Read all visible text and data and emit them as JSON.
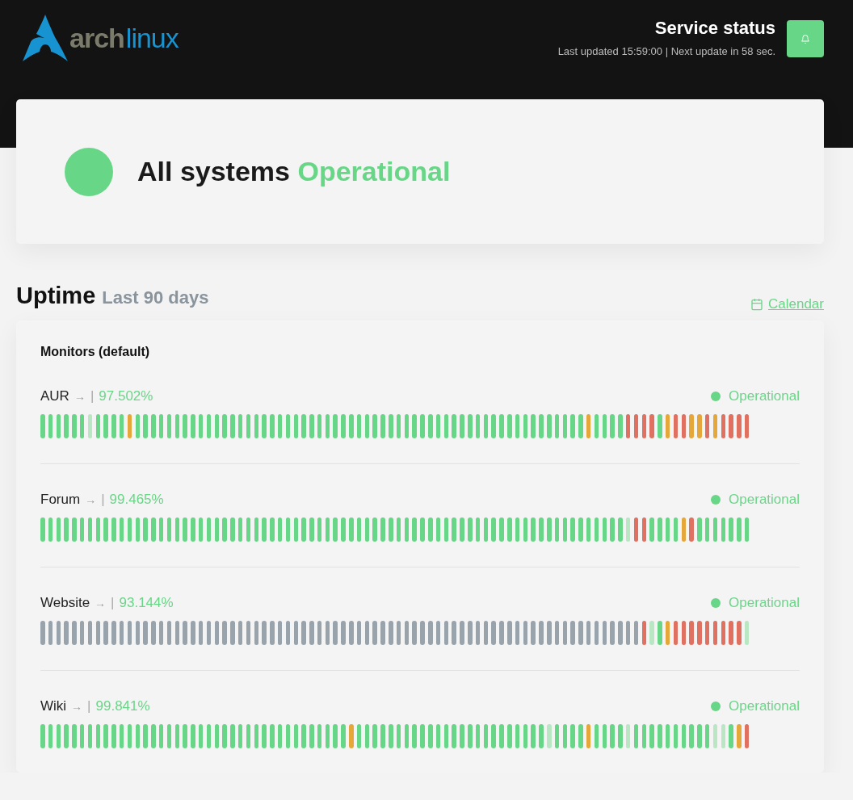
{
  "header": {
    "logo": {
      "part_1": "arch",
      "part_2": "linux"
    },
    "title": "Service status",
    "subtitle": "Last updated 15:59:00 | Next update in 58 sec."
  },
  "overall": {
    "color": "#68d687",
    "prefix": "All systems",
    "status_text": "Operational"
  },
  "uptime": {
    "title": "Uptime",
    "period": "Last 90 days",
    "calendar_link": "Calendar"
  },
  "monitors_group": {
    "title": "Monitors (default)",
    "monitors": [
      {
        "name": "AUR",
        "arrow": "→",
        "separator": "|",
        "uptime": "97.502%",
        "color": "#68d687",
        "status_text": "Operational",
        "days": [
          {
            "color": "#68d687"
          },
          {
            "color": "#68d687"
          },
          {
            "color": "#68d687"
          },
          {
            "color": "#68d687"
          },
          {
            "color": "#68d687"
          },
          {
            "color": "#68d687"
          },
          {
            "color": "#b9e6c3"
          },
          {
            "color": "#68d687"
          },
          {
            "color": "#68d687"
          },
          {
            "color": "#68d687"
          },
          {
            "color": "#68d687"
          },
          {
            "color": "#e5a73a"
          },
          {
            "color": "#68d687"
          },
          {
            "color": "#68d687"
          },
          {
            "color": "#68d687"
          },
          {
            "color": "#68d687"
          },
          {
            "color": "#68d687"
          },
          {
            "color": "#68d687"
          },
          {
            "color": "#68d687"
          },
          {
            "color": "#68d687"
          },
          {
            "color": "#68d687"
          },
          {
            "color": "#68d687"
          },
          {
            "color": "#68d687"
          },
          {
            "color": "#68d687"
          },
          {
            "color": "#68d687"
          },
          {
            "color": "#68d687"
          },
          {
            "color": "#68d687"
          },
          {
            "color": "#68d687"
          },
          {
            "color": "#68d687"
          },
          {
            "color": "#68d687"
          },
          {
            "color": "#68d687"
          },
          {
            "color": "#68d687"
          },
          {
            "color": "#68d687"
          },
          {
            "color": "#68d687"
          },
          {
            "color": "#68d687"
          },
          {
            "color": "#68d687"
          },
          {
            "color": "#68d687"
          },
          {
            "color": "#68d687"
          },
          {
            "color": "#68d687"
          },
          {
            "color": "#68d687"
          },
          {
            "color": "#68d687"
          },
          {
            "color": "#68d687"
          },
          {
            "color": "#68d687"
          },
          {
            "color": "#68d687"
          },
          {
            "color": "#68d687"
          },
          {
            "color": "#68d687"
          },
          {
            "color": "#68d687"
          },
          {
            "color": "#68d687"
          },
          {
            "color": "#68d687"
          },
          {
            "color": "#68d687"
          },
          {
            "color": "#68d687"
          },
          {
            "color": "#68d687"
          },
          {
            "color": "#68d687"
          },
          {
            "color": "#68d687"
          },
          {
            "color": "#68d687"
          },
          {
            "color": "#68d687"
          },
          {
            "color": "#68d687"
          },
          {
            "color": "#68d687"
          },
          {
            "color": "#68d687"
          },
          {
            "color": "#68d687"
          },
          {
            "color": "#68d687"
          },
          {
            "color": "#68d687"
          },
          {
            "color": "#68d687"
          },
          {
            "color": "#68d687"
          },
          {
            "color": "#68d687"
          },
          {
            "color": "#68d687"
          },
          {
            "color": "#68d687"
          },
          {
            "color": "#68d687"
          },
          {
            "color": "#68d687"
          },
          {
            "color": "#e5a73a"
          },
          {
            "color": "#68d687"
          },
          {
            "color": "#68d687"
          },
          {
            "color": "#68d687"
          },
          {
            "color": "#68d687"
          },
          {
            "color": "#e0705f"
          },
          {
            "color": "#e0705f"
          },
          {
            "color": "#e0705f"
          },
          {
            "color": "#e0705f"
          },
          {
            "color": "#68d687"
          },
          {
            "color": "#e5a73a"
          },
          {
            "color": "#e0705f"
          },
          {
            "color": "#e0705f"
          },
          {
            "color": "#e5a73a"
          },
          {
            "color": "#e5a73a"
          },
          {
            "color": "#e0705f"
          },
          {
            "color": "#e5a73a"
          },
          {
            "color": "#e0705f"
          },
          {
            "color": "#e0705f"
          },
          {
            "color": "#e0705f"
          },
          {
            "color": "#e0705f"
          }
        ]
      },
      {
        "name": "Forum",
        "arrow": "→",
        "separator": "|",
        "uptime": "99.465%",
        "color": "#68d687",
        "status_text": "Operational",
        "days": [
          {
            "color": "#68d687"
          },
          {
            "color": "#68d687"
          },
          {
            "color": "#68d687"
          },
          {
            "color": "#68d687"
          },
          {
            "color": "#68d687"
          },
          {
            "color": "#68d687"
          },
          {
            "color": "#68d687"
          },
          {
            "color": "#68d687"
          },
          {
            "color": "#68d687"
          },
          {
            "color": "#68d687"
          },
          {
            "color": "#68d687"
          },
          {
            "color": "#68d687"
          },
          {
            "color": "#68d687"
          },
          {
            "color": "#68d687"
          },
          {
            "color": "#68d687"
          },
          {
            "color": "#68d687"
          },
          {
            "color": "#68d687"
          },
          {
            "color": "#68d687"
          },
          {
            "color": "#68d687"
          },
          {
            "color": "#68d687"
          },
          {
            "color": "#68d687"
          },
          {
            "color": "#68d687"
          },
          {
            "color": "#68d687"
          },
          {
            "color": "#68d687"
          },
          {
            "color": "#68d687"
          },
          {
            "color": "#68d687"
          },
          {
            "color": "#68d687"
          },
          {
            "color": "#68d687"
          },
          {
            "color": "#68d687"
          },
          {
            "color": "#68d687"
          },
          {
            "color": "#68d687"
          },
          {
            "color": "#68d687"
          },
          {
            "color": "#68d687"
          },
          {
            "color": "#68d687"
          },
          {
            "color": "#68d687"
          },
          {
            "color": "#68d687"
          },
          {
            "color": "#68d687"
          },
          {
            "color": "#68d687"
          },
          {
            "color": "#68d687"
          },
          {
            "color": "#68d687"
          },
          {
            "color": "#68d687"
          },
          {
            "color": "#68d687"
          },
          {
            "color": "#68d687"
          },
          {
            "color": "#68d687"
          },
          {
            "color": "#68d687"
          },
          {
            "color": "#68d687"
          },
          {
            "color": "#68d687"
          },
          {
            "color": "#68d687"
          },
          {
            "color": "#68d687"
          },
          {
            "color": "#68d687"
          },
          {
            "color": "#68d687"
          },
          {
            "color": "#68d687"
          },
          {
            "color": "#68d687"
          },
          {
            "color": "#68d687"
          },
          {
            "color": "#68d687"
          },
          {
            "color": "#68d687"
          },
          {
            "color": "#68d687"
          },
          {
            "color": "#68d687"
          },
          {
            "color": "#68d687"
          },
          {
            "color": "#68d687"
          },
          {
            "color": "#68d687"
          },
          {
            "color": "#68d687"
          },
          {
            "color": "#68d687"
          },
          {
            "color": "#68d687"
          },
          {
            "color": "#68d687"
          },
          {
            "color": "#68d687"
          },
          {
            "color": "#68d687"
          },
          {
            "color": "#68d687"
          },
          {
            "color": "#68d687"
          },
          {
            "color": "#68d687"
          },
          {
            "color": "#68d687"
          },
          {
            "color": "#68d687"
          },
          {
            "color": "#68d687"
          },
          {
            "color": "#68d687"
          },
          {
            "color": "#b9e6c3"
          },
          {
            "color": "#e0705f"
          },
          {
            "color": "#e0705f"
          },
          {
            "color": "#68d687"
          },
          {
            "color": "#68d687"
          },
          {
            "color": "#68d687"
          },
          {
            "color": "#68d687"
          },
          {
            "color": "#e5a73a"
          },
          {
            "color": "#e0705f"
          },
          {
            "color": "#68d687"
          },
          {
            "color": "#68d687"
          },
          {
            "color": "#68d687"
          },
          {
            "color": "#68d687"
          },
          {
            "color": "#68d687"
          },
          {
            "color": "#68d687"
          },
          {
            "color": "#68d687"
          }
        ]
      },
      {
        "name": "Website",
        "arrow": "→",
        "separator": "|",
        "uptime": "93.144%",
        "color": "#68d687",
        "status_text": "Operational",
        "days": [
          {
            "color": "#99a3ab"
          },
          {
            "color": "#99a3ab"
          },
          {
            "color": "#99a3ab"
          },
          {
            "color": "#99a3ab"
          },
          {
            "color": "#99a3ab"
          },
          {
            "color": "#99a3ab"
          },
          {
            "color": "#99a3ab"
          },
          {
            "color": "#99a3ab"
          },
          {
            "color": "#99a3ab"
          },
          {
            "color": "#99a3ab"
          },
          {
            "color": "#99a3ab"
          },
          {
            "color": "#99a3ab"
          },
          {
            "color": "#99a3ab"
          },
          {
            "color": "#99a3ab"
          },
          {
            "color": "#99a3ab"
          },
          {
            "color": "#99a3ab"
          },
          {
            "color": "#99a3ab"
          },
          {
            "color": "#99a3ab"
          },
          {
            "color": "#99a3ab"
          },
          {
            "color": "#99a3ab"
          },
          {
            "color": "#99a3ab"
          },
          {
            "color": "#99a3ab"
          },
          {
            "color": "#99a3ab"
          },
          {
            "color": "#99a3ab"
          },
          {
            "color": "#99a3ab"
          },
          {
            "color": "#99a3ab"
          },
          {
            "color": "#99a3ab"
          },
          {
            "color": "#99a3ab"
          },
          {
            "color": "#99a3ab"
          },
          {
            "color": "#99a3ab"
          },
          {
            "color": "#99a3ab"
          },
          {
            "color": "#99a3ab"
          },
          {
            "color": "#99a3ab"
          },
          {
            "color": "#99a3ab"
          },
          {
            "color": "#99a3ab"
          },
          {
            "color": "#99a3ab"
          },
          {
            "color": "#99a3ab"
          },
          {
            "color": "#99a3ab"
          },
          {
            "color": "#99a3ab"
          },
          {
            "color": "#99a3ab"
          },
          {
            "color": "#99a3ab"
          },
          {
            "color": "#99a3ab"
          },
          {
            "color": "#99a3ab"
          },
          {
            "color": "#99a3ab"
          },
          {
            "color": "#99a3ab"
          },
          {
            "color": "#99a3ab"
          },
          {
            "color": "#99a3ab"
          },
          {
            "color": "#99a3ab"
          },
          {
            "color": "#99a3ab"
          },
          {
            "color": "#99a3ab"
          },
          {
            "color": "#99a3ab"
          },
          {
            "color": "#99a3ab"
          },
          {
            "color": "#99a3ab"
          },
          {
            "color": "#99a3ab"
          },
          {
            "color": "#99a3ab"
          },
          {
            "color": "#99a3ab"
          },
          {
            "color": "#99a3ab"
          },
          {
            "color": "#99a3ab"
          },
          {
            "color": "#99a3ab"
          },
          {
            "color": "#99a3ab"
          },
          {
            "color": "#99a3ab"
          },
          {
            "color": "#99a3ab"
          },
          {
            "color": "#99a3ab"
          },
          {
            "color": "#99a3ab"
          },
          {
            "color": "#99a3ab"
          },
          {
            "color": "#99a3ab"
          },
          {
            "color": "#99a3ab"
          },
          {
            "color": "#99a3ab"
          },
          {
            "color": "#99a3ab"
          },
          {
            "color": "#99a3ab"
          },
          {
            "color": "#99a3ab"
          },
          {
            "color": "#99a3ab"
          },
          {
            "color": "#99a3ab"
          },
          {
            "color": "#99a3ab"
          },
          {
            "color": "#99a3ab"
          },
          {
            "color": "#99a3ab"
          },
          {
            "color": "#e0705f"
          },
          {
            "color": "#b9e6c3"
          },
          {
            "color": "#68d687"
          },
          {
            "color": "#e5a73a"
          },
          {
            "color": "#e0705f"
          },
          {
            "color": "#e0705f"
          },
          {
            "color": "#e0705f"
          },
          {
            "color": "#e0705f"
          },
          {
            "color": "#e0705f"
          },
          {
            "color": "#e0705f"
          },
          {
            "color": "#e0705f"
          },
          {
            "color": "#e0705f"
          },
          {
            "color": "#e0705f"
          },
          {
            "color": "#b9e6c3"
          }
        ]
      },
      {
        "name": "Wiki",
        "arrow": "→",
        "separator": "|",
        "uptime": "99.841%",
        "color": "#68d687",
        "status_text": "Operational",
        "days": [
          {
            "color": "#68d687"
          },
          {
            "color": "#68d687"
          },
          {
            "color": "#68d687"
          },
          {
            "color": "#68d687"
          },
          {
            "color": "#68d687"
          },
          {
            "color": "#68d687"
          },
          {
            "color": "#68d687"
          },
          {
            "color": "#68d687"
          },
          {
            "color": "#68d687"
          },
          {
            "color": "#68d687"
          },
          {
            "color": "#68d687"
          },
          {
            "color": "#68d687"
          },
          {
            "color": "#68d687"
          },
          {
            "color": "#68d687"
          },
          {
            "color": "#68d687"
          },
          {
            "color": "#68d687"
          },
          {
            "color": "#68d687"
          },
          {
            "color": "#68d687"
          },
          {
            "color": "#68d687"
          },
          {
            "color": "#68d687"
          },
          {
            "color": "#68d687"
          },
          {
            "color": "#68d687"
          },
          {
            "color": "#68d687"
          },
          {
            "color": "#68d687"
          },
          {
            "color": "#68d687"
          },
          {
            "color": "#68d687"
          },
          {
            "color": "#68d687"
          },
          {
            "color": "#68d687"
          },
          {
            "color": "#68d687"
          },
          {
            "color": "#68d687"
          },
          {
            "color": "#68d687"
          },
          {
            "color": "#68d687"
          },
          {
            "color": "#68d687"
          },
          {
            "color": "#68d687"
          },
          {
            "color": "#68d687"
          },
          {
            "color": "#68d687"
          },
          {
            "color": "#68d687"
          },
          {
            "color": "#68d687"
          },
          {
            "color": "#68d687"
          },
          {
            "color": "#e5a73a"
          },
          {
            "color": "#68d687"
          },
          {
            "color": "#68d687"
          },
          {
            "color": "#68d687"
          },
          {
            "color": "#68d687"
          },
          {
            "color": "#68d687"
          },
          {
            "color": "#68d687"
          },
          {
            "color": "#68d687"
          },
          {
            "color": "#68d687"
          },
          {
            "color": "#68d687"
          },
          {
            "color": "#68d687"
          },
          {
            "color": "#68d687"
          },
          {
            "color": "#68d687"
          },
          {
            "color": "#68d687"
          },
          {
            "color": "#68d687"
          },
          {
            "color": "#68d687"
          },
          {
            "color": "#68d687"
          },
          {
            "color": "#68d687"
          },
          {
            "color": "#68d687"
          },
          {
            "color": "#68d687"
          },
          {
            "color": "#68d687"
          },
          {
            "color": "#68d687"
          },
          {
            "color": "#68d687"
          },
          {
            "color": "#68d687"
          },
          {
            "color": "#68d687"
          },
          {
            "color": "#b9e6c3"
          },
          {
            "color": "#68d687"
          },
          {
            "color": "#68d687"
          },
          {
            "color": "#68d687"
          },
          {
            "color": "#68d687"
          },
          {
            "color": "#e5a73a"
          },
          {
            "color": "#68d687"
          },
          {
            "color": "#68d687"
          },
          {
            "color": "#68d687"
          },
          {
            "color": "#68d687"
          },
          {
            "color": "#b9e6c3"
          },
          {
            "color": "#68d687"
          },
          {
            "color": "#68d687"
          },
          {
            "color": "#68d687"
          },
          {
            "color": "#68d687"
          },
          {
            "color": "#68d687"
          },
          {
            "color": "#68d687"
          },
          {
            "color": "#68d687"
          },
          {
            "color": "#68d687"
          },
          {
            "color": "#68d687"
          },
          {
            "color": "#68d687"
          },
          {
            "color": "#b9e6c3"
          },
          {
            "color": "#b9e6c3"
          },
          {
            "color": "#68d687"
          },
          {
            "color": "#e5a73a"
          },
          {
            "color": "#e0705f"
          }
        ]
      }
    ]
  }
}
